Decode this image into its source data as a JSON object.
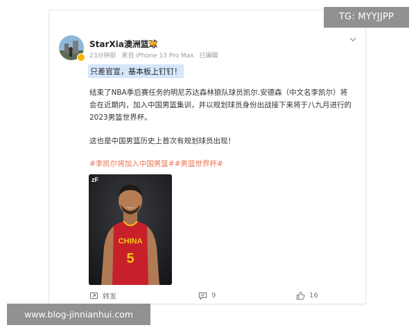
{
  "post": {
    "username": "StarXia澳洲篮球",
    "meta": {
      "time": "23分钟前",
      "source": "来自 iPhone 13 Pro Max",
      "edited": "已编辑"
    },
    "highlight_text": "只差官宣，基本板上钉钉！",
    "paragraph_lines": [
      "结束了NBA季后赛任务的明尼苏达森林狼队球员凯尔.安德森（中文名李凯尔）将",
      "会在近期内，加入中国男篮集训，并以规划球员身份出战接下来将于八九月进行的",
      "2023男篮世界杯。"
    ],
    "paragraph2": "这也是中国男篮历史上首次有规划球员出现！",
    "hashtags": "#李凯尔将加入中国男篮##男篮世界杯#",
    "image": {
      "corner_text": "zF",
      "jersey_text": "CHINA",
      "jersey_number": "5"
    },
    "actions": {
      "repost_label": "转发",
      "comment_count": "9",
      "like_count": "16"
    }
  },
  "watermarks": {
    "tg": "TG: MYYJJPP",
    "site": "www.blog-jinnianhui.com"
  },
  "colors": {
    "hashtag": "#eb7350",
    "highlight_bg": "#d6e6fb",
    "jersey_red": "#c8202a",
    "jersey_gold": "#f0c419",
    "vip_badge": "#f7b500"
  },
  "icons": [
    "chevron-down-icon",
    "crown-icon",
    "verified-badge-icon",
    "repost-icon",
    "comment-icon",
    "like-icon"
  ]
}
